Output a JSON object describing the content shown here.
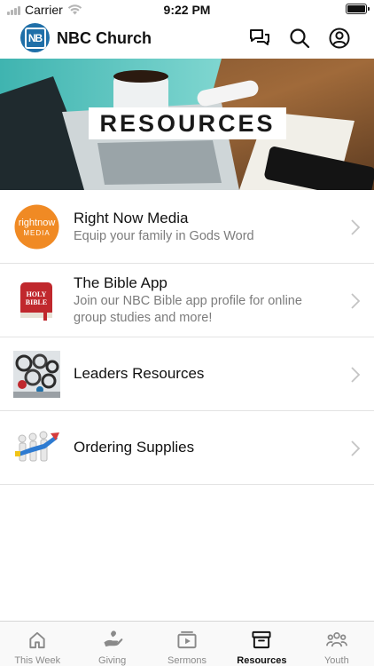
{
  "status_bar": {
    "carrier": "Carrier",
    "time": "9:22 PM",
    "battery_level": 1.0
  },
  "header": {
    "logo_text": "NB",
    "title": "NBC Church",
    "icons": [
      "chat-icon",
      "search-icon",
      "profile-icon"
    ]
  },
  "banner": {
    "title": "RESOURCES",
    "accent_color": "#2a9a9a"
  },
  "resources": [
    {
      "title": "Right Now Media",
      "subtitle": "Equip your family in Gods Word",
      "thumb_line1": "rightnow",
      "thumb_line2": "MEDIA",
      "thumb_color": "#f08a24"
    },
    {
      "title": "The Bible App",
      "subtitle": "Join our NBC Bible app profile for online group studies and more!",
      "thumb_line1": "HOLY",
      "thumb_line2": "BIBLE",
      "thumb_color": "#c0282d"
    },
    {
      "title": "Leaders Resources",
      "subtitle": ""
    },
    {
      "title": "Ordering Supplies",
      "subtitle": ""
    }
  ],
  "tabs": [
    {
      "label": "This Week",
      "icon": "home-icon",
      "active": false
    },
    {
      "label": "Giving",
      "icon": "giving-hand-icon",
      "active": false
    },
    {
      "label": "Sermons",
      "icon": "video-icon",
      "active": false
    },
    {
      "label": "Resources",
      "icon": "archive-box-icon",
      "active": true
    },
    {
      "label": "Youth",
      "icon": "people-icon",
      "active": false
    }
  ],
  "colors": {
    "tab_inactive": "#8a8a8a",
    "tab_active": "#111111",
    "logo_blue": "#1f6fa8"
  }
}
